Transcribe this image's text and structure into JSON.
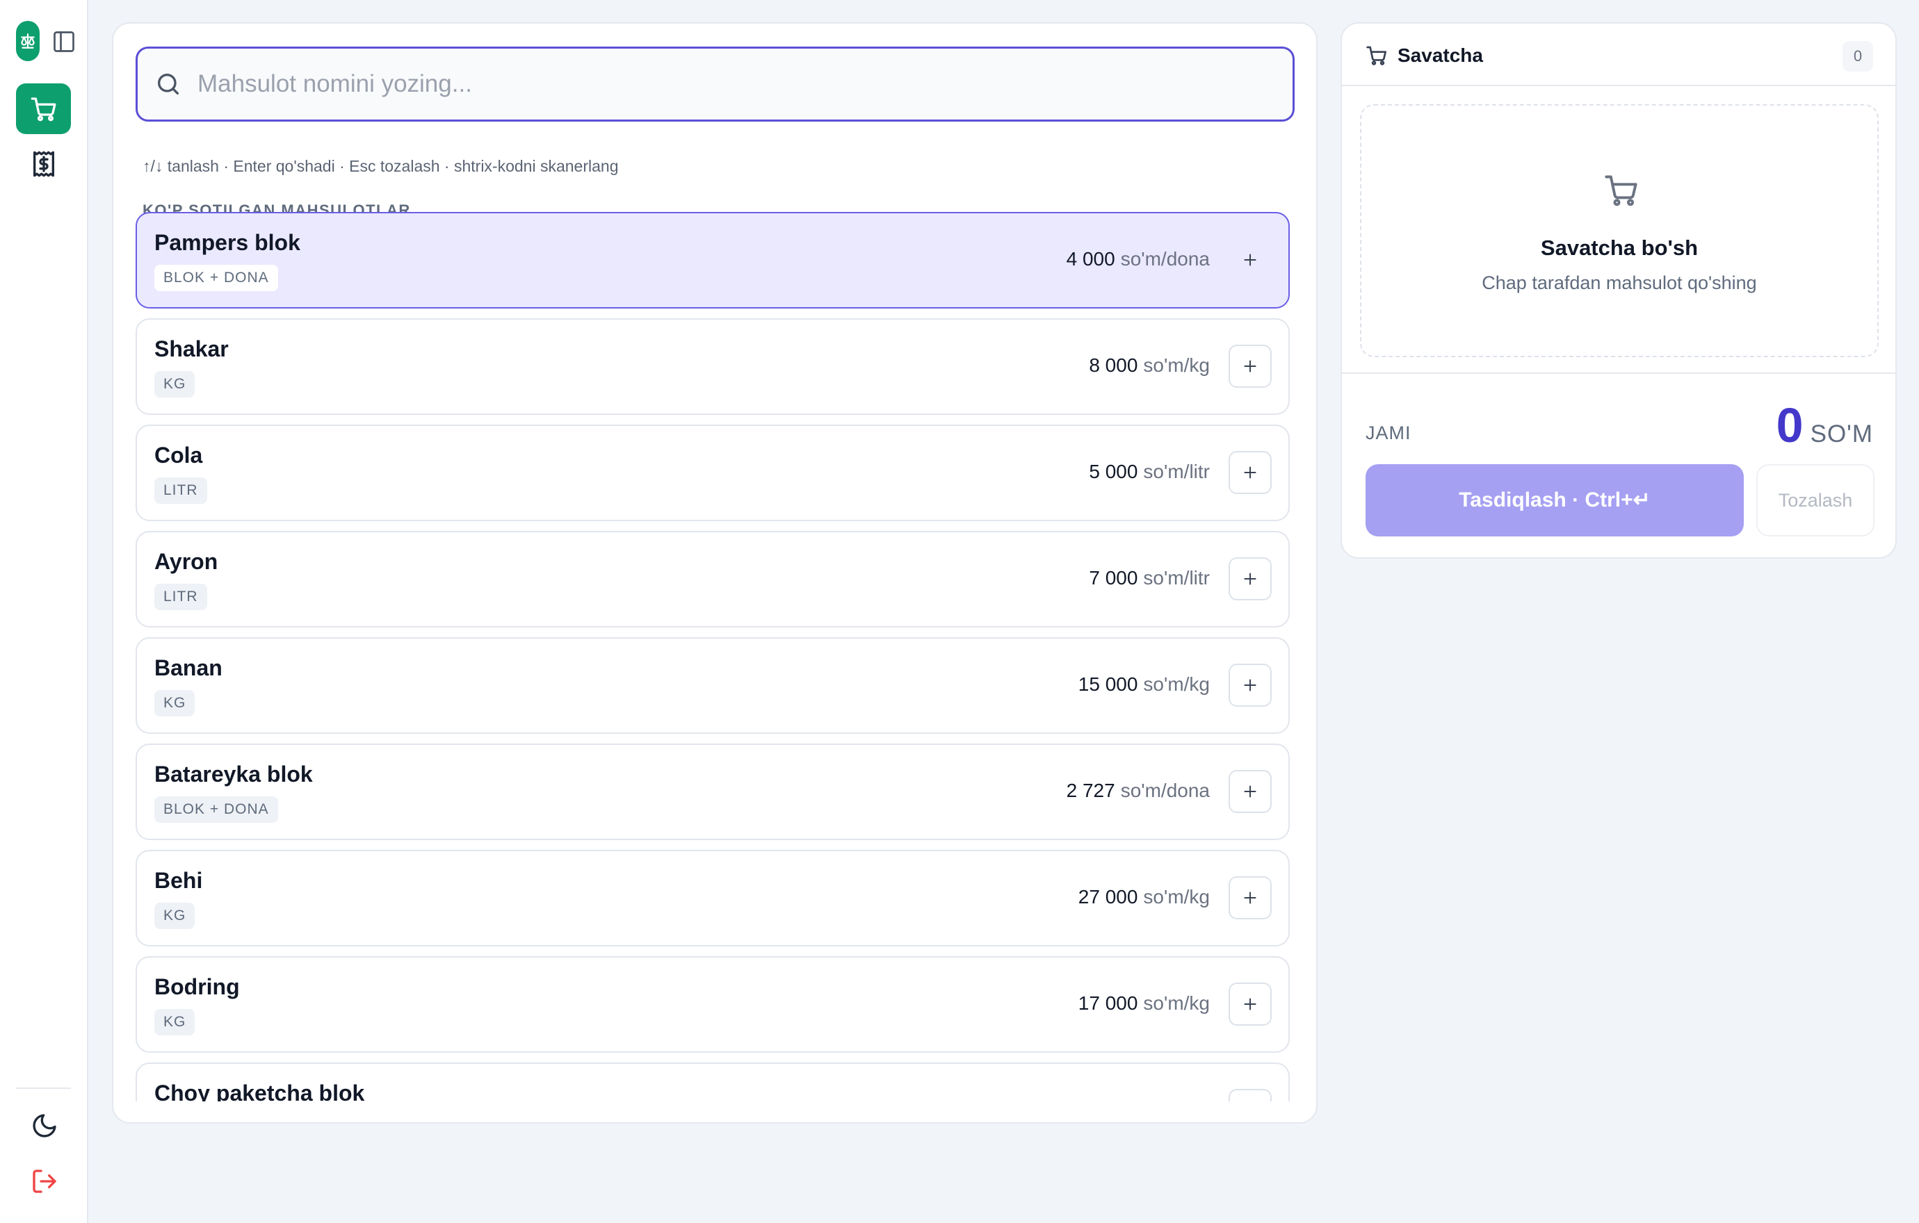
{
  "rail": {
    "logo_icon": "scales-icon",
    "items": [
      {
        "icon": "cart-icon",
        "active": true
      },
      {
        "icon": "receipt-dollar-icon",
        "active": false
      }
    ],
    "bottom": [
      {
        "icon": "moon-icon"
      },
      {
        "icon": "logout-icon"
      }
    ]
  },
  "search": {
    "placeholder": "Mahsulot nomini yozing...",
    "value": "",
    "hint": "↑/↓ tanlash · Enter qo'shadi · Esc tozalash · shtrix-kodni skanerlang"
  },
  "section_title": "KO'P SOTILGAN MAHSULOTLAR",
  "products": [
    {
      "name": "Pampers blok",
      "tag": "BLOK + DONA",
      "price": "4 000",
      "unit": "so'm/dona",
      "selected": true
    },
    {
      "name": "Shakar",
      "tag": "KG",
      "price": "8 000",
      "unit": "so'm/kg"
    },
    {
      "name": "Cola",
      "tag": "LITR",
      "price": "5 000",
      "unit": "so'm/litr"
    },
    {
      "name": "Ayron",
      "tag": "LITR",
      "price": "7 000",
      "unit": "so'm/litr"
    },
    {
      "name": "Banan",
      "tag": "KG",
      "price": "15 000",
      "unit": "so'm/kg"
    },
    {
      "name": "Batareyka blok",
      "tag": "BLOK + DONA",
      "price": "2 727",
      "unit": "so'm/dona"
    },
    {
      "name": "Behi",
      "tag": "KG",
      "price": "27 000",
      "unit": "so'm/kg"
    },
    {
      "name": "Bodring",
      "tag": "KG",
      "price": "17 000",
      "unit": "so'm/kg"
    },
    {
      "name": "Choy paketcha blok",
      "tag": "",
      "price": "",
      "unit": ""
    }
  ],
  "cart": {
    "title": "Savatcha",
    "count": "0",
    "empty_title": "Savatcha bo'sh",
    "empty_subtitle": "Chap tarafdan mahsulot qo'shing",
    "total_label": "JAMI",
    "total_value": "0",
    "total_currency": "SO'M",
    "confirm_label": "Tasdiqlash · Ctrl+↵",
    "clear_label": "Tozalash"
  },
  "colors": {
    "brand_green": "#0e9f6e",
    "accent_indigo": "#4338ca",
    "selected_row_bg": "#ebe9fe",
    "confirm_disabled": "#a5a0f2",
    "logout_red": "#ef4444"
  }
}
